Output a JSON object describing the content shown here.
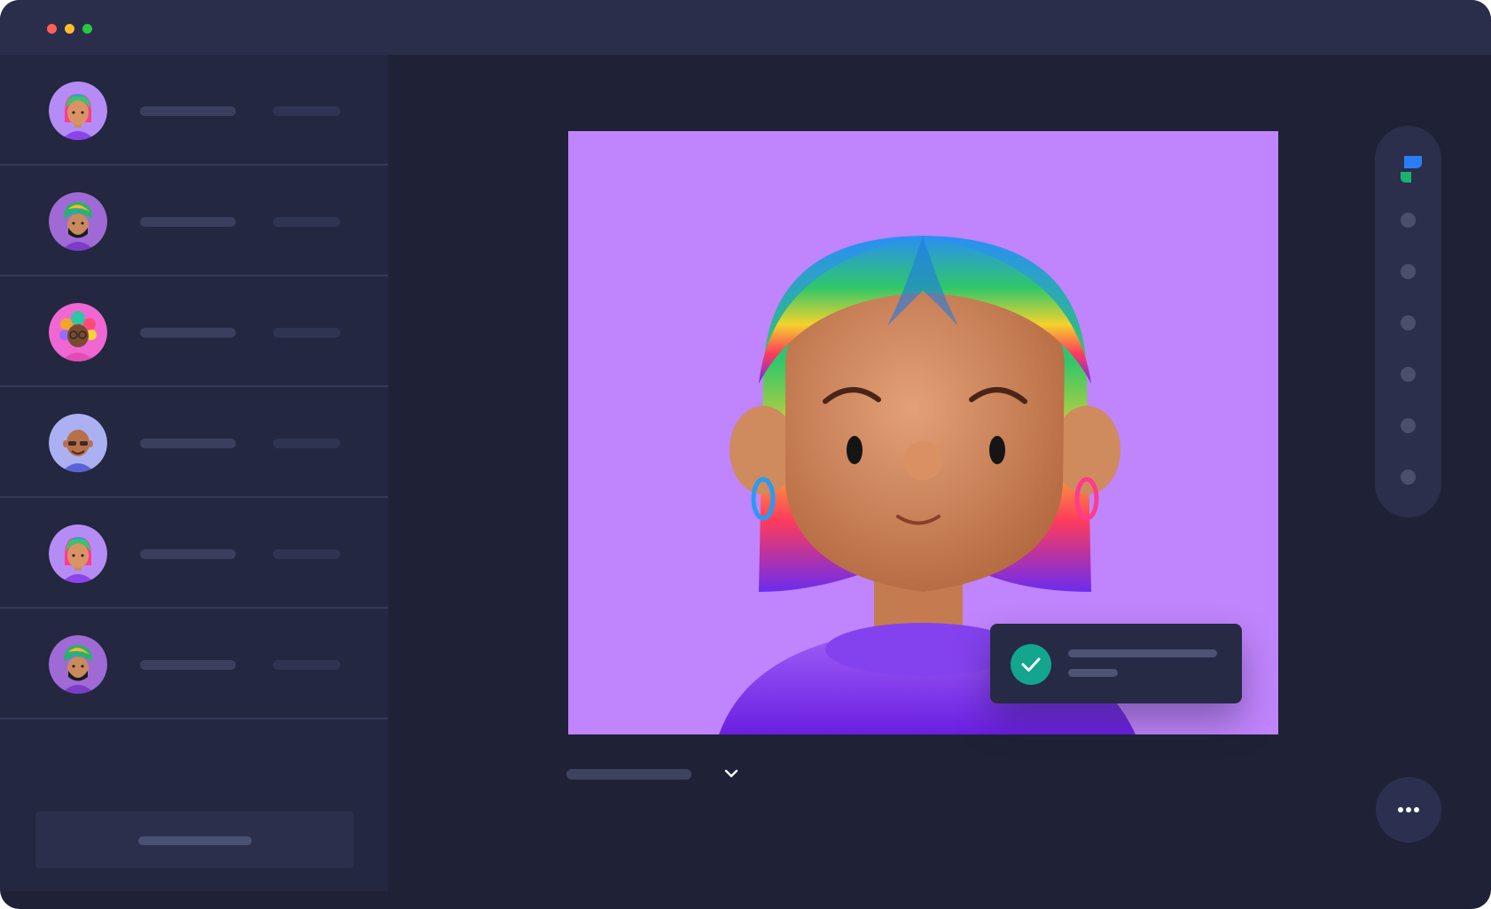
{
  "window": {
    "controls": [
      "close",
      "minimize",
      "maximize"
    ]
  },
  "sidebar": {
    "contacts": [
      {
        "avatar": "avatar-rainbow-hair",
        "avatar_bg": "#b58cf5"
      },
      {
        "avatar": "avatar-turban-beard",
        "avatar_bg": "#a06ad6"
      },
      {
        "avatar": "avatar-curly-hair-glasses",
        "avatar_bg": "#f067d3"
      },
      {
        "avatar": "avatar-bald-glasses",
        "avatar_bg": "#aab0f2"
      },
      {
        "avatar": "avatar-rainbow-hair",
        "avatar_bg": "#b58cf5"
      },
      {
        "avatar": "avatar-turban-beard",
        "avatar_bg": "#a06ad6"
      }
    ]
  },
  "main": {
    "video": {
      "subject": "avatar-rainbow-hair",
      "background": "#c084fc"
    },
    "notification": {
      "icon": "check-icon",
      "accent": "#13a58e"
    },
    "caption_dropdown_icon": "chevron-down-icon"
  },
  "rail": {
    "logo": "app-logo-icon",
    "items": 6
  },
  "more_button_icon": "more-dots-icon"
}
